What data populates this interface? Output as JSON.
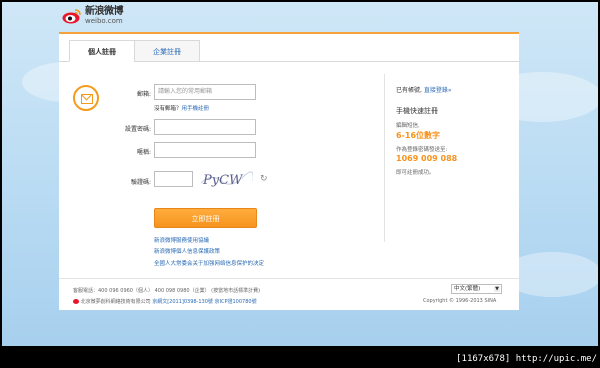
{
  "logo": {
    "cn": "新浪微博",
    "en": "weibo.com",
    "icon": "weibo-eye-logo"
  },
  "tabs": [
    {
      "label": "個人註冊",
      "active": true
    },
    {
      "label": "企業註冊",
      "active": false
    }
  ],
  "form": {
    "email_label": "郵箱:",
    "email_placeholder": "請輸入您的常用郵箱",
    "no_email_text": "沒有郵箱？",
    "phone_register_link": "用手機註冊",
    "password_label": "設置密碼:",
    "nickname_label": "暱稱:",
    "captcha_label": "驗證碼:",
    "captcha_text": "PyCW",
    "refresh_icon": "refresh-icon",
    "submit_label": "立即註冊",
    "links": [
      "新浪微博服務使用協議",
      "新浪微博個人信息保護政策",
      "全國人大常委会关于加强网络信息保护的决定"
    ]
  },
  "side": {
    "have_account": "已有帳號,",
    "login_link": "直接登錄»",
    "quick_title": "手機快速註冊",
    "edit_sms": "編輯短信,",
    "digits": "6-16位數字",
    "send_as_password": "作為登錄密碼發送至:",
    "phone_number": "1069 009 088",
    "done": "即可註冊成功。"
  },
  "footer": {
    "hotline": "客服電話：400 096 0960（個人） 400 098 0980（企業） (按當地市話標準計費)",
    "company": "北京微夢創科網絡技術有限公司",
    "icp1": "京網文[2011]0398-130號",
    "icp2": "京ICP證100780號",
    "language": "中文(繁體)",
    "copyright": "Copyright © 1996-2013 SINA"
  },
  "watermark": "[1167x678] http://upic.me/",
  "colors": {
    "accent": "#f7931e",
    "link": "#2a6ab5",
    "background": "#b9dbf3"
  }
}
